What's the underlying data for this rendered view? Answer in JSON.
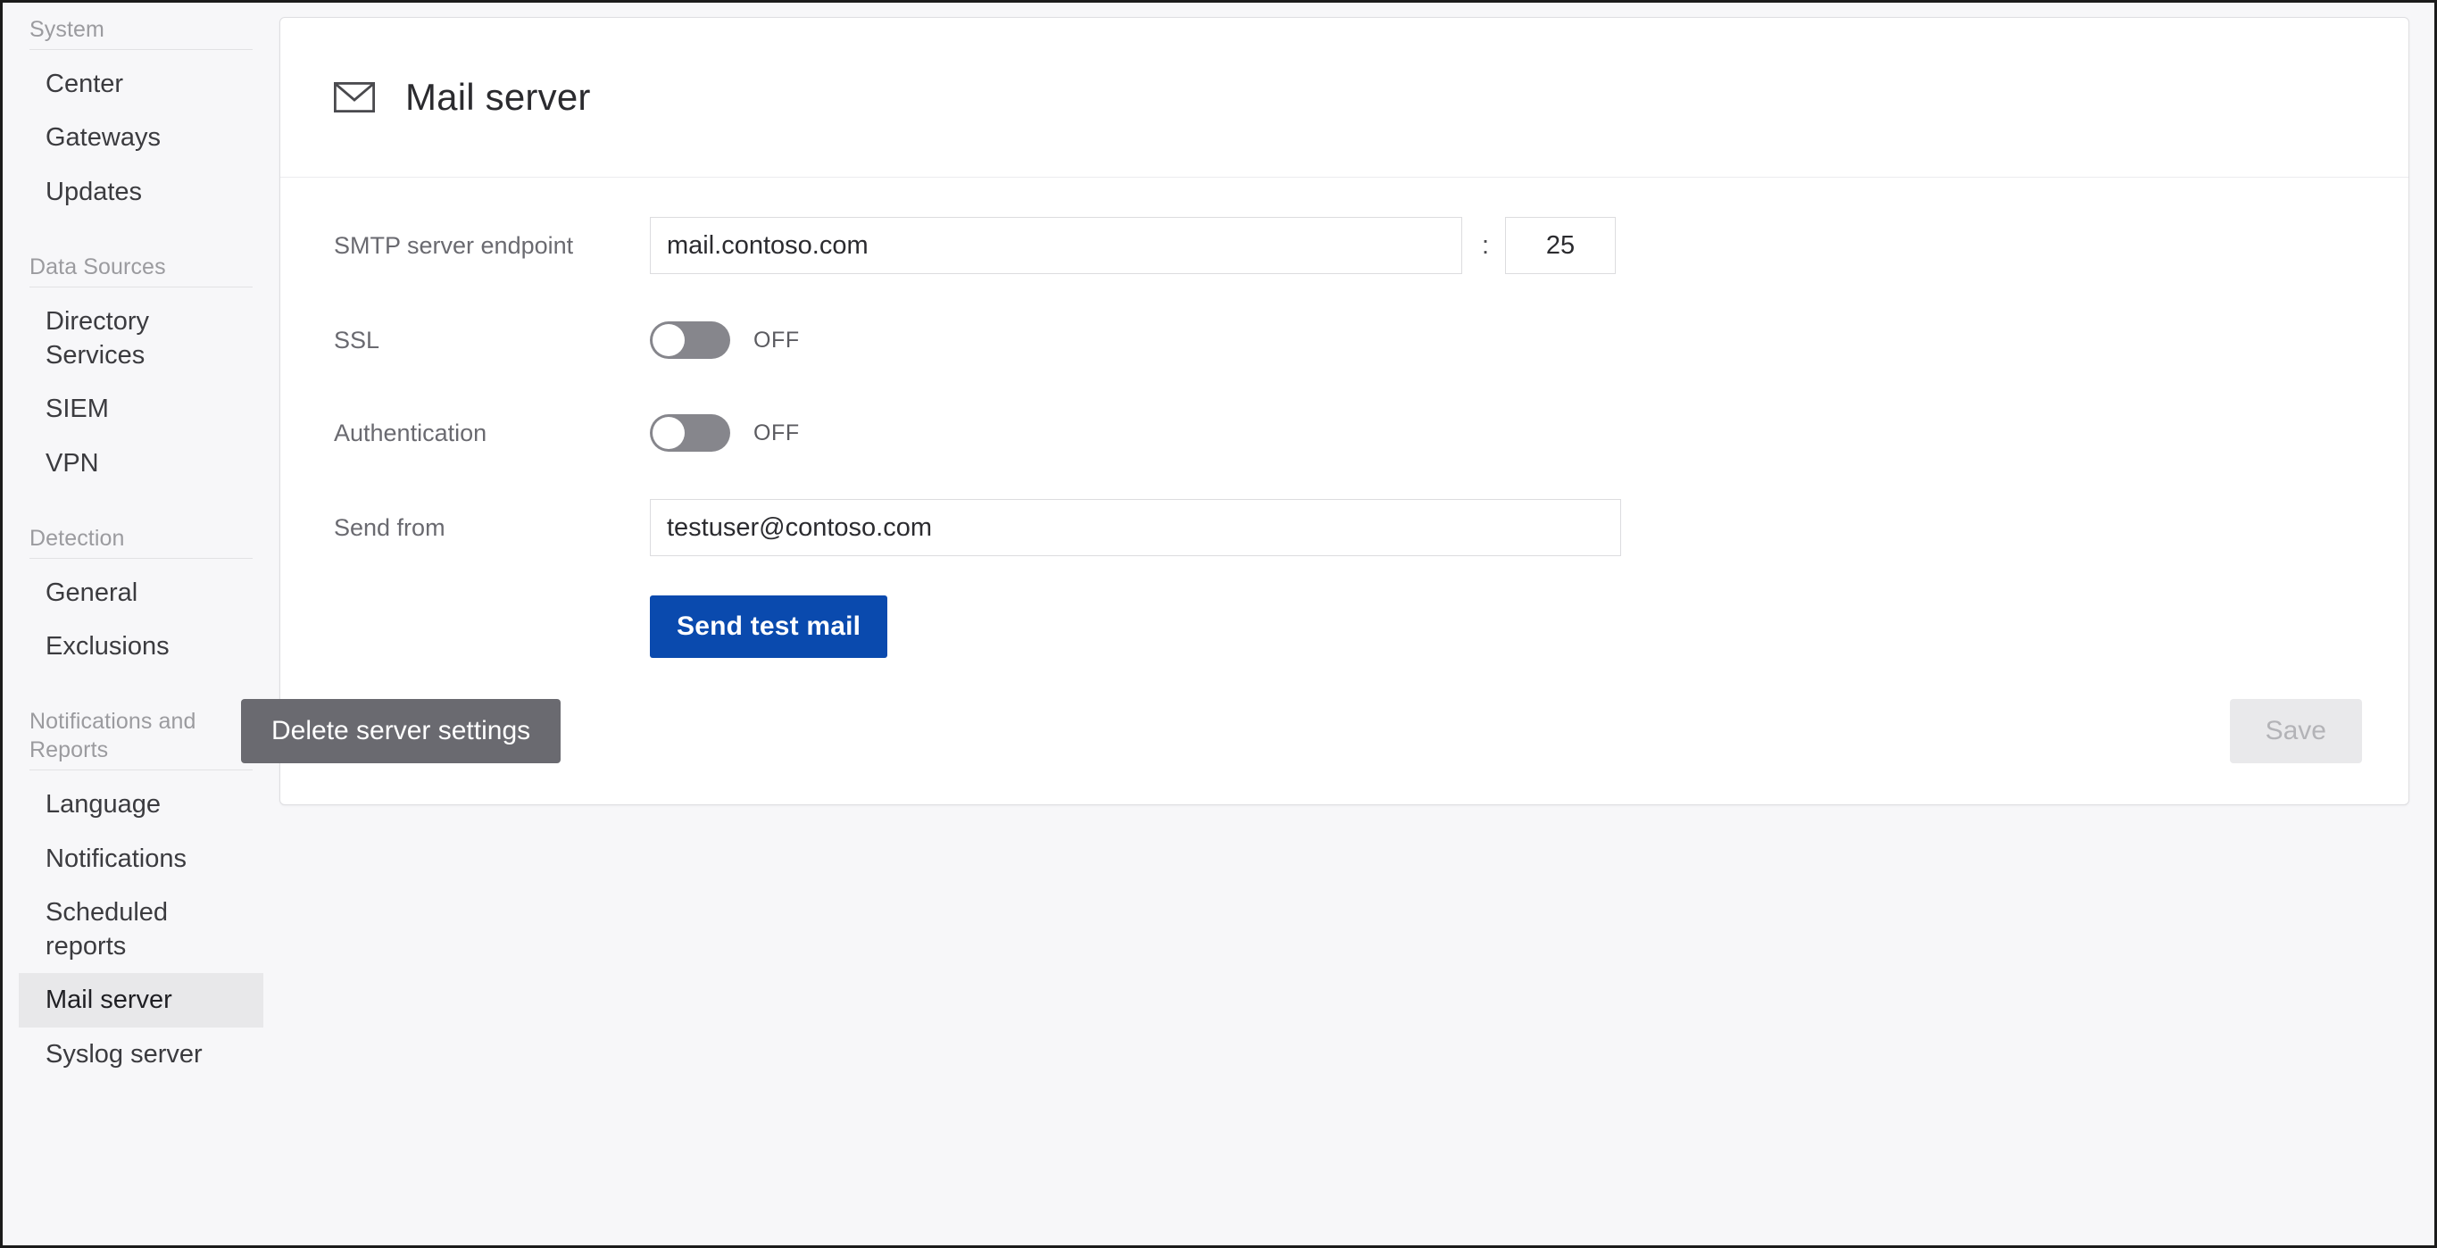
{
  "sidebar": {
    "groups": [
      {
        "header": "System",
        "items": [
          {
            "label": "Center",
            "selected": false
          },
          {
            "label": "Gateways",
            "selected": false
          },
          {
            "label": "Updates",
            "selected": false
          }
        ]
      },
      {
        "header": "Data Sources",
        "items": [
          {
            "label": "Directory Services",
            "selected": false
          },
          {
            "label": "SIEM",
            "selected": false
          },
          {
            "label": "VPN",
            "selected": false
          }
        ]
      },
      {
        "header": "Detection",
        "items": [
          {
            "label": "General",
            "selected": false
          },
          {
            "label": "Exclusions",
            "selected": false
          }
        ]
      },
      {
        "header": "Notifications and Reports",
        "items": [
          {
            "label": "Language",
            "selected": false
          },
          {
            "label": "Notifications",
            "selected": false
          },
          {
            "label": "Scheduled reports",
            "selected": false
          },
          {
            "label": "Mail server",
            "selected": true
          },
          {
            "label": "Syslog server",
            "selected": false
          }
        ]
      }
    ]
  },
  "page": {
    "icon": "mail-envelope-icon",
    "title": "Mail server"
  },
  "form": {
    "smtp": {
      "label": "SMTP server endpoint",
      "host_value": "mail.contoso.com",
      "host_placeholder": "",
      "separator": ":",
      "port_value": "25",
      "port_placeholder": ""
    },
    "ssl": {
      "label": "SSL",
      "state": "OFF",
      "on": false
    },
    "authentication": {
      "label": "Authentication",
      "state": "OFF",
      "on": false
    },
    "send_from": {
      "label": "Send from",
      "value": "testuser@contoso.com",
      "placeholder": ""
    },
    "send_test_label": "Send test mail"
  },
  "footer": {
    "delete_label": "Delete server settings",
    "save_label": "Save"
  },
  "colors": {
    "primary_button": "#0a4aae",
    "delete_button": "#6a6a70",
    "save_disabled_bg": "#e9e9eb",
    "save_disabled_text": "#b3b3b7",
    "toggle_off": "#86868c",
    "selected_nav": "#e8e8ea",
    "page_bg": "#f7f7f9",
    "label_text": "#6a6a70"
  }
}
